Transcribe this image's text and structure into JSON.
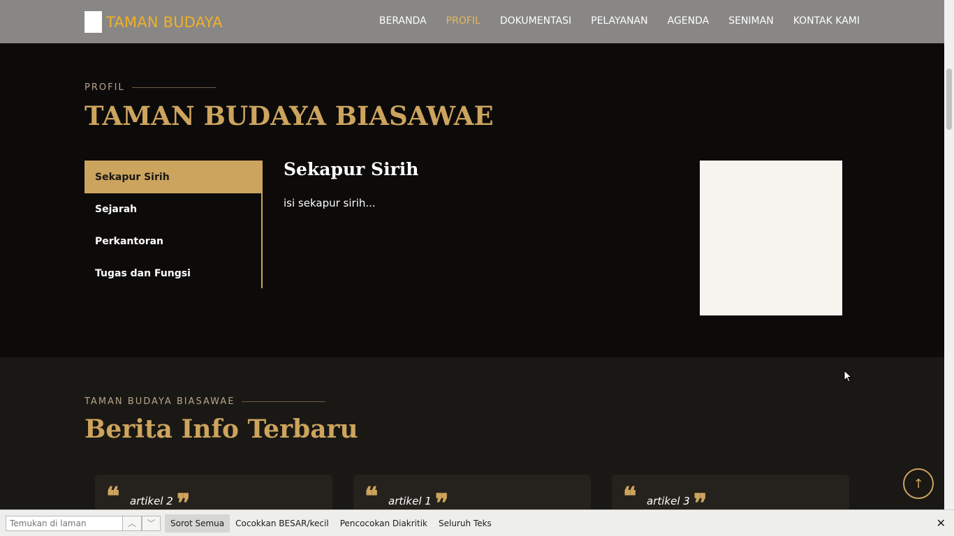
{
  "brand": {
    "name": "TAMAN BUDAYA"
  },
  "nav": {
    "items": [
      {
        "label": "BERANDA"
      },
      {
        "label": "PROFIL"
      },
      {
        "label": "DOKUMENTASI"
      },
      {
        "label": "PELAYANAN"
      },
      {
        "label": "AGENDA"
      },
      {
        "label": "SENIMAN"
      },
      {
        "label": "KONTAK KAMI"
      }
    ],
    "active": "PROFIL"
  },
  "profil": {
    "eyebrow": "PROFIL",
    "title": "TAMAN BUDAYA BIASAWAE",
    "tabs": [
      {
        "label": "Sekapur Sirih"
      },
      {
        "label": "Sejarah"
      },
      {
        "label": "Perkantoran"
      },
      {
        "label": "Tugas dan Fungsi"
      }
    ],
    "active_tab": "Sekapur Sirih",
    "content_title": "Sekapur Sirih",
    "content_text": "isi sekapur sirih..."
  },
  "berita": {
    "eyebrow": "TAMAN BUDAYA BIASAWAE",
    "title": "Berita Info Terbaru",
    "cards": [
      {
        "title": "artikel 2"
      },
      {
        "title": "artikel 1"
      },
      {
        "title": "artikel 3"
      }
    ]
  },
  "findbar": {
    "placeholder": "Temukan di laman",
    "options": {
      "highlight_all": "Sorot Semua",
      "match_case": "Cocokkan BESAR/kecil",
      "match_diacritics": "Pencocokan Diakritik",
      "whole_words": "Seluruh Teks"
    }
  },
  "colors": {
    "accent": "#cda45e",
    "brand": "#f0b02a",
    "nav_bg": "#888785",
    "section_dark": "#0d0b0a",
    "section_alt": "#1a1814"
  },
  "icons": {
    "back_to_top": "arrow-up-icon",
    "close": "close-icon",
    "prev": "chevron-up-icon",
    "next": "chevron-down-icon",
    "quote": "quote-icon"
  }
}
